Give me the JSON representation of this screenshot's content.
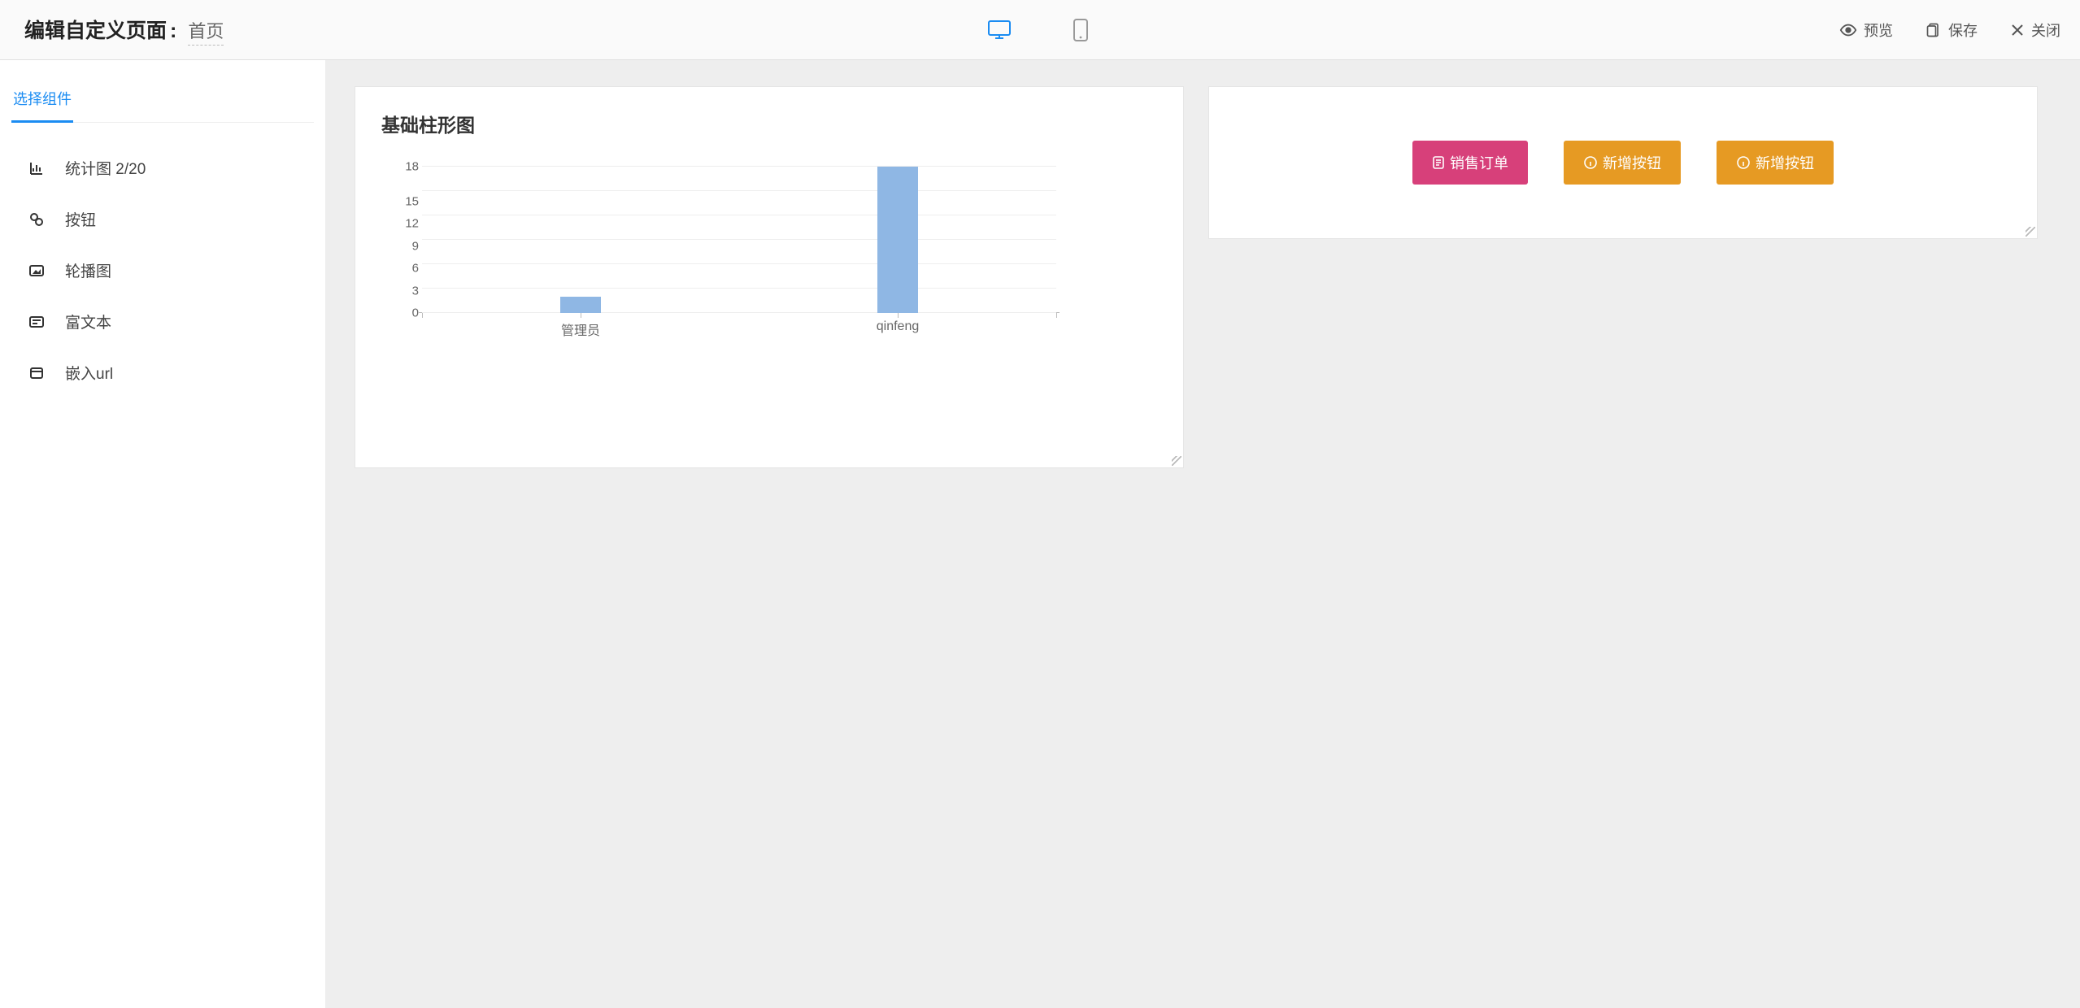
{
  "header": {
    "title_prefix": "编辑自定义页面",
    "colon": ":",
    "page_name": "首页",
    "preview_label": "预览",
    "save_label": "保存",
    "close_label": "关闭"
  },
  "sidebar": {
    "tab_label": "选择组件",
    "items": [
      {
        "label": "统计图 2/20",
        "icon": "chart-icon"
      },
      {
        "label": "按钮",
        "icon": "button-icon"
      },
      {
        "label": "轮播图",
        "icon": "image-icon"
      },
      {
        "label": "富文本",
        "icon": "richtext-icon"
      },
      {
        "label": "嵌入url",
        "icon": "url-icon"
      }
    ]
  },
  "canvas": {
    "chart_widget": {
      "title": "基础柱形图"
    },
    "buttons_widget": {
      "buttons": [
        {
          "label": "销售订单",
          "color": "pink",
          "icon": "doc-icon"
        },
        {
          "label": "新增按钮",
          "color": "orange",
          "icon": "info-icon"
        },
        {
          "label": "新增按钮",
          "color": "orange",
          "icon": "info-icon"
        }
      ]
    }
  },
  "chart_data": {
    "type": "bar",
    "title": "基础柱形图",
    "categories": [
      "管理员",
      "qinfeng"
    ],
    "values": [
      2,
      18
    ],
    "y_ticks": [
      0,
      3,
      6,
      9,
      12,
      15,
      18
    ],
    "ylim": [
      0,
      18
    ],
    "xlabel": "",
    "ylabel": ""
  }
}
